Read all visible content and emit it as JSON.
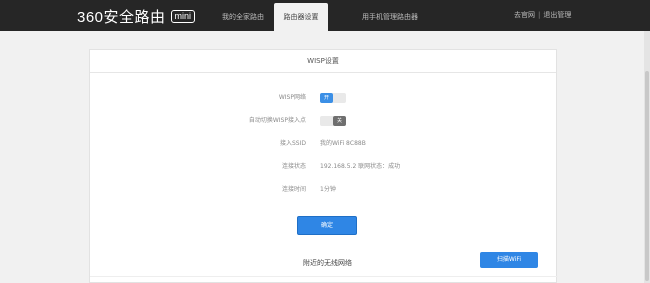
{
  "header": {
    "brand": "360安全路由",
    "brand_badge": "mini",
    "tabs": [
      {
        "label": "我的全家路由",
        "active": false
      },
      {
        "label": "路由器设置",
        "active": true
      },
      {
        "label": "用手机管理路由器",
        "active": false
      }
    ],
    "links": {
      "forum": "去官网",
      "separator": "|",
      "logout": "退出管理"
    },
    "bg_color": "#262626"
  },
  "card": {
    "title": "WISP设置",
    "rows": [
      {
        "label": "WISP网络",
        "toggle_text": "开",
        "toggle_state": "on"
      },
      {
        "label": "自动切换WISP接入点",
        "toggle_text": "关",
        "toggle_state": "off"
      },
      {
        "label": "接入SSID",
        "value": "我的WiFi 8C88B"
      },
      {
        "label": "连接状态",
        "value": "192.168.5.2  联网状态：成功"
      },
      {
        "label": "连接时间",
        "value": "1分钟"
      }
    ],
    "confirm_label": "确定",
    "section_title": "附近的无线网络",
    "scan_label": "扫描WiFi",
    "accent_color": "#2f86e5"
  }
}
